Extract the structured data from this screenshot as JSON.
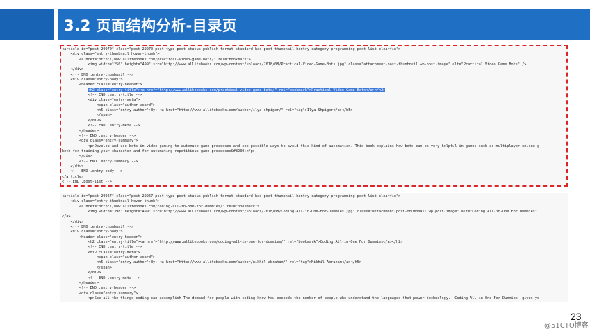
{
  "slide": {
    "title": "3.2 页面结构分析-目录页",
    "page_number": "23",
    "watermark": "@51CTO博客"
  },
  "colors": {
    "header": "#1f6fc5",
    "dashed_border": "#d8262b",
    "highlight": "#3b78d8"
  },
  "code_block_1": {
    "before_highlight": "<article id=\"post-29970\" class=\"post-29970 post type-post status-publish format-standard has-post-thumbnail hentry category-programming post-list clearfix\">\n    <div class=\"entry-thumbnail hover-thumb\">\n        <a href=\"http://www.allitebooks.com/practical-video-game-bots/\" rel=\"bookmark\">\n            <img width=\"250\" height=\"499\" src=\"http://www.allitebooks.com/wp-content/uploads/2018/08/Practical-Video-Game-Bots.jpg\" class=\"attachment-post-thumbnail wp-post-image\" alt=\"Practical Video Game Bots\" />\n    </div>\n    <!-- END .entry-thumbnail -->\n    <div class=\"entry-body\">\n        <header class=\"entry-header\">\n            ",
    "highlight": "<h2 class=\"entry-title\"><a href=\"http://www.allitebooks.com/practical-video-game-bots/\" rel=\"bookmark\">Practical Video Game Bots</a></h2>",
    "after_highlight": "\n            <!-- END .entry-title -->\n            <div class=\"entry-meta\">\n                <span class=\"author vcard\">\n                <h5 class=\"entry-author\">By: <a href=\"http://www.allitebooks.com/author/ilya-shpigor/\" rel=\"tag\">Ilya Shpigor</a></h5>\n                </span>\n            </div>\n            <!-- END .entry-meta -->\n        </header>\n        <!-- END .entry-header -->\n        <div class=\"entry-summary\">\n            <p>Develop and use bots in video gaming to automate game processes and see possible ways to avoid this kind of automation. This book explains how bots can be very helpful in games such as multiplayer online g\nboth for training your character and for automating repetitious game processes&#8230;</p>\n        </div>\n        <!-- END .entry-summary -->\n    </div>\n    <!-- END .entry-body -->\n</article>\n<!-- END .post-list -->"
  },
  "code_block_2": {
    "text": "<article id=\"post-29967\" class=\"post-29967 post type-post status-publish format-standard has-post-thumbnail hentry category-programming post-list clearfix\">\n    <div class=\"entry-thumbnail hover-thumb\">\n        <a href=\"http://www.allitebooks.com/coding-all-in-one-for-dummies/\" rel=\"bookmark\">\n            <img width=\"398\" height=\"499\" src=\"http://www.allitebooks.com/wp-content/uploads/2018/08/Coding-All-in-One-For-Dummies.jpg\" class=\"attachment-post-thumbnail wp-post-image\" alt=\"Coding All-in-One For Dummies\"\n</a>\n    </div>\n    <!-- END .entry-thumbnail -->\n    <div class=\"entry-body\">\n        <header class=\"entry-header\">\n            <h2 class=\"entry-title\"><a href=\"http://www.allitebooks.com/coding-all-in-one-for-dummies/\" rel=\"bookmark\">Coding All-in-One For Dummies</a></h2>\n            <!-- END .entry-title -->\n            <div class=\"entry-meta\">\n                <span class=\"author vcard\">\n                <h5 class=\"entry-author\">By: <a href=\"http://www.allitebooks.com/author/nikhil-abraham/\" rel=\"tag\">Nikhil Abraham</a></h5>\n                </span>\n            </div>\n            <!-- END .entry-meta -->\n        </header>\n        <!-- END .entry-header -->\n        <div class=\"entry-summary\">\n            <p>See all the things coding can accomplish The demand for people with coding know-how exceeds the number of people who understand the languages that power technology.  Coding All-in-One For Dummies  gives yo"
  }
}
